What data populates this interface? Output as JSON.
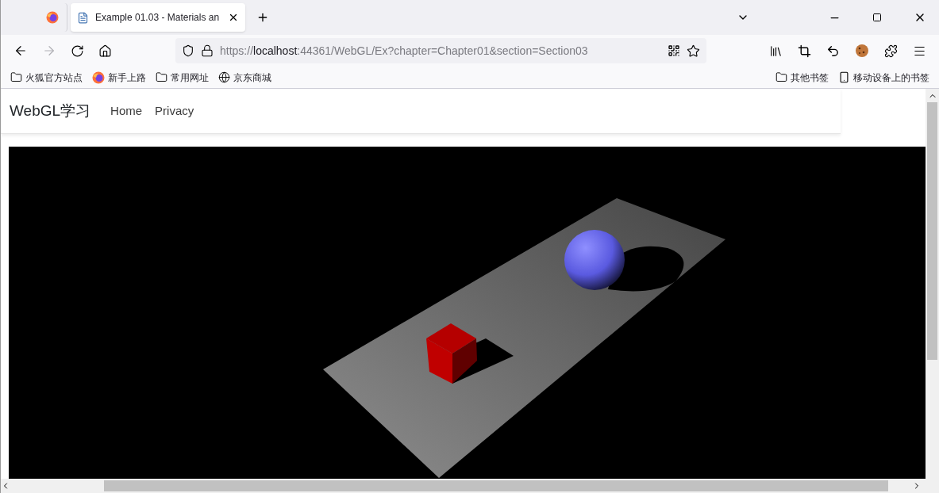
{
  "tabs": [
    {
      "kind": "pinned",
      "selected": false
    },
    {
      "kind": "page",
      "title": "Example 01.03 - Materials an",
      "selected": true
    }
  ],
  "address": {
    "prefix": "https://",
    "host": "localhost",
    "suffix": ":44361/WebGL/Ex?chapter=Chapter01&section=Section03"
  },
  "bookmarks_left": [
    {
      "kind": "folder",
      "label": "火狐官方站点"
    },
    {
      "kind": "firefox",
      "label": "新手上路"
    },
    {
      "kind": "folder",
      "label": "常用网址"
    },
    {
      "kind": "globe",
      "label": "京东商城"
    }
  ],
  "bookmarks_right": [
    {
      "kind": "folder",
      "label": "其他书签"
    },
    {
      "kind": "mobile",
      "label": "移动设备上的书签"
    }
  ],
  "page": {
    "brand": "WebGL学习",
    "nav": [
      "Home",
      "Privacy"
    ]
  }
}
